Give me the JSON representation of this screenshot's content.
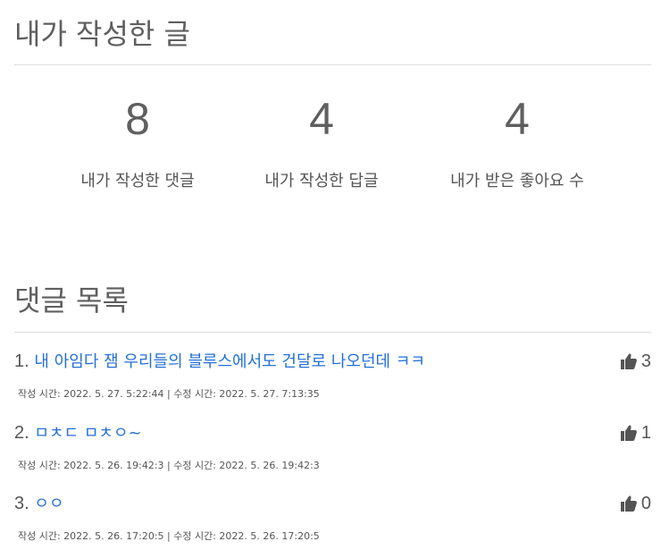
{
  "my_posts": {
    "title": "내가 작성한 글",
    "stats": [
      {
        "value": "8",
        "label": "내가 작성한 댓글"
      },
      {
        "value": "4",
        "label": "내가 작성한 답글"
      },
      {
        "value": "4",
        "label": "내가 받은 좋아요 수"
      }
    ]
  },
  "comments": {
    "title": "댓글 목록",
    "items": [
      {
        "index": "1.",
        "text": "내 아임다 잼 우리들의 블루스에서도 건달로 나오던데 ㅋㅋ",
        "meta": "작성 시간: 2022. 5. 27. 5:22:44 | 수정 시간: 2022. 5. 27. 7:13:35",
        "likes": "3"
      },
      {
        "index": "2.",
        "text": "ㅁㅊㄷ ㅁㅊㅇ~",
        "meta": "작성 시간: 2022. 5. 26. 19:42:3 | 수정 시간: 2022. 5. 26. 19:42:3",
        "likes": "1"
      },
      {
        "index": "3.",
        "text": "ㅇㅇ",
        "meta": "작성 시간: 2022. 5. 26. 17:20:5 | 수정 시간: 2022. 5. 26. 17:20:5",
        "likes": "0"
      }
    ]
  },
  "icons": {
    "like": "thumbs-up-icon"
  },
  "colors": {
    "link": "#2470d8",
    "text": "#5f5f5f",
    "divider": "#dedede"
  }
}
